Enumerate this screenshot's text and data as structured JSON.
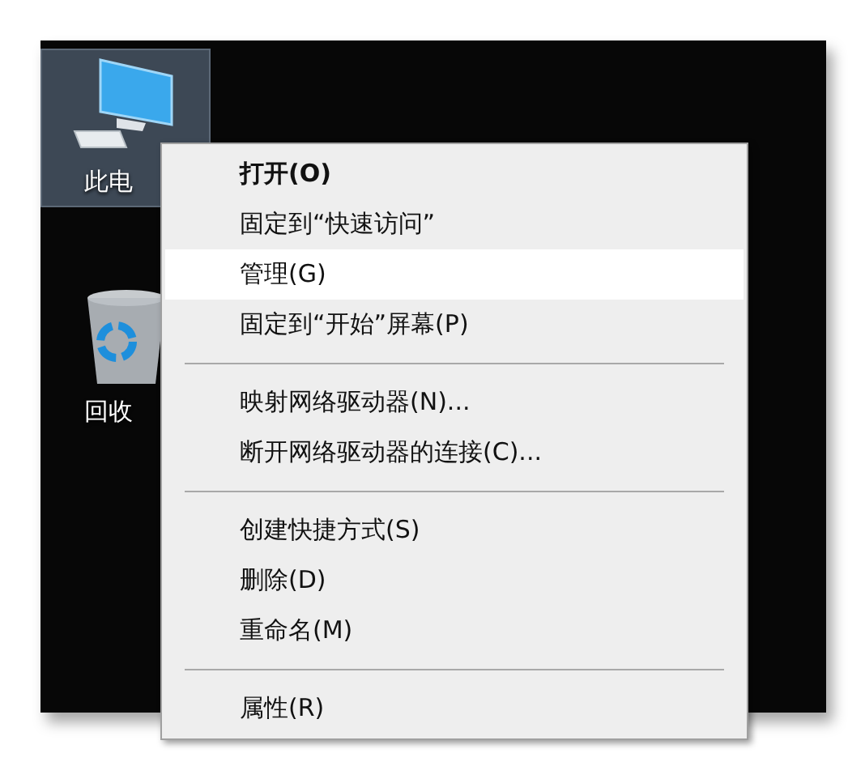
{
  "desktop_icons": [
    {
      "label": "此电",
      "kind": "computer",
      "selected": true
    },
    {
      "label": "回收",
      "kind": "recycle-bin",
      "selected": false
    }
  ],
  "context_menu": {
    "items": [
      {
        "kind": "item",
        "label": "打开(O)",
        "default": true,
        "selected": false
      },
      {
        "kind": "item",
        "label": "固定到“快速访问”",
        "default": false,
        "selected": false
      },
      {
        "kind": "item",
        "label": "管理(G)",
        "default": false,
        "selected": true
      },
      {
        "kind": "item",
        "label": "固定到“开始”屏幕(P)",
        "default": false,
        "selected": false
      },
      {
        "kind": "separator"
      },
      {
        "kind": "item",
        "label": "映射网络驱动器(N)...",
        "default": false,
        "selected": false
      },
      {
        "kind": "item",
        "label": "断开网络驱动器的连接(C)...",
        "default": false,
        "selected": false
      },
      {
        "kind": "separator"
      },
      {
        "kind": "item",
        "label": "创建快捷方式(S)",
        "default": false,
        "selected": false
      },
      {
        "kind": "item",
        "label": "删除(D)",
        "default": false,
        "selected": false
      },
      {
        "kind": "item",
        "label": "重命名(M)",
        "default": false,
        "selected": false
      },
      {
        "kind": "separator"
      },
      {
        "kind": "item",
        "label": "属性(R)",
        "default": false,
        "selected": false
      }
    ]
  }
}
